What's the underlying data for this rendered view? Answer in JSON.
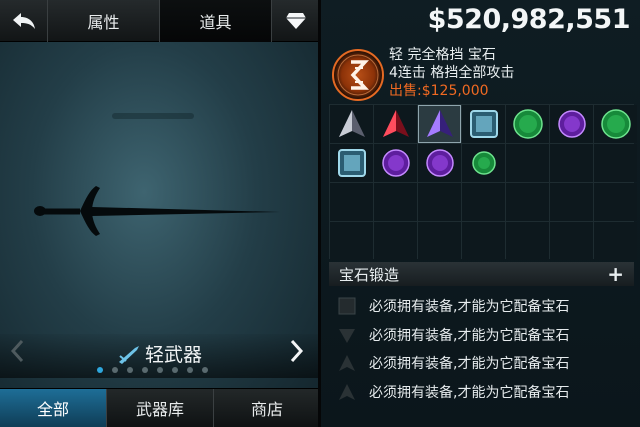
{
  "left": {
    "tabs": {
      "attributes": "属性",
      "items": "道具"
    },
    "weapon_category": "轻武器",
    "page_count": 8,
    "active_page": 0,
    "bottom_tabs": [
      "全部",
      "武器库",
      "商店"
    ]
  },
  "right": {
    "money": "$520,982,551",
    "selected": {
      "line1": "轻 完全格挡 宝石",
      "line2": "4连击 格挡全部攻击",
      "sale": "出售:$125,000"
    },
    "gems_row1": [
      "gray-triangle",
      "red-triangle",
      "purple-triangle",
      "blue-square",
      "green-round",
      "purple-round",
      "green-round"
    ],
    "gems_row2": [
      "blue-square",
      "purple-round",
      "purple-round",
      "green-round-small"
    ],
    "forge_label": "宝石锻造",
    "slots": [
      {
        "shape": "square",
        "text": "必须拥有装备,才能为它配备宝石"
      },
      {
        "shape": "down-triangle",
        "text": "必须拥有装备,才能为它配备宝石"
      },
      {
        "shape": "up-triangle",
        "text": "必须拥有装备,才能为它配备宝石"
      },
      {
        "shape": "up-triangle",
        "text": "必须拥有装备,才能为它配备宝石"
      }
    ]
  },
  "colors": {
    "accent": "#2ea7dd",
    "sale": "#f06a22",
    "active_tab": "#1e6e97"
  }
}
